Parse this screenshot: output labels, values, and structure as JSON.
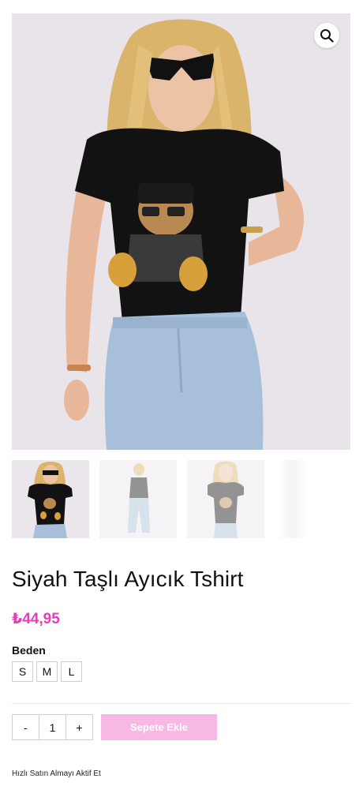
{
  "product": {
    "title": "Siyah Taşlı Ayıcık Tshirt",
    "price": "₺44,95",
    "price_color": "#e83cba",
    "main_image": "woman-black-bear-tshirt-jeans-photo",
    "zoom_icon": "search-icon"
  },
  "gallery": {
    "thumbnails": [
      {
        "image": "model-front-closeup-thumb"
      },
      {
        "image": "model-full-body-thumb"
      },
      {
        "image": "model-front-thumb"
      }
    ]
  },
  "size": {
    "label": "Beden",
    "options": [
      "S",
      "M",
      "L"
    ]
  },
  "cart": {
    "minus": "-",
    "quantity": "1",
    "plus": "+",
    "add_label": "Sepete Ekle",
    "add_color": "#f7b8e3"
  },
  "footer": {
    "quick_buy": "Hızlı Satın Almayı Aktif Et"
  }
}
